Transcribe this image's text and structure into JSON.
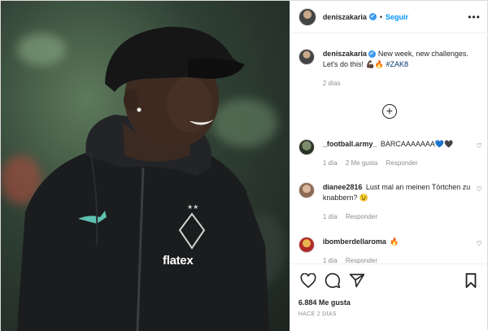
{
  "header": {
    "username": "deniszakaria",
    "verified_mark": "✔",
    "separator": "•",
    "follow_label": "Seguir",
    "more_label": "•••"
  },
  "caption": {
    "username": "deniszakaria",
    "text": "New week, new challenges. Let's do this! 💪🏿🔥",
    "hashtag": "#ZAK8",
    "time": "2 días"
  },
  "load_more_label": "+",
  "comments": [
    {
      "username": "_football.army_",
      "text": "BARCAAAAAAA💙🖤",
      "time": "1 día",
      "likes": "2 Me gusta",
      "reply": "Responder"
    },
    {
      "username": "dianee2816",
      "text": "Lust mal an meinen Törtchen zu knabbern? 😉",
      "time": "1 día",
      "reply": "Responder"
    },
    {
      "username": "ibomberdellaroma",
      "text": "🔥",
      "time": "1 día",
      "reply": "Responder"
    }
  ],
  "footer": {
    "likes": "6.884 Me gusta",
    "date": "HACE 2 DÍAS"
  },
  "photo": {
    "logo_text": "flatex",
    "brand": "puma"
  },
  "colors": {
    "accent": "#0095f6",
    "verified": "#3897f0",
    "muted": "#8e8e8e"
  }
}
